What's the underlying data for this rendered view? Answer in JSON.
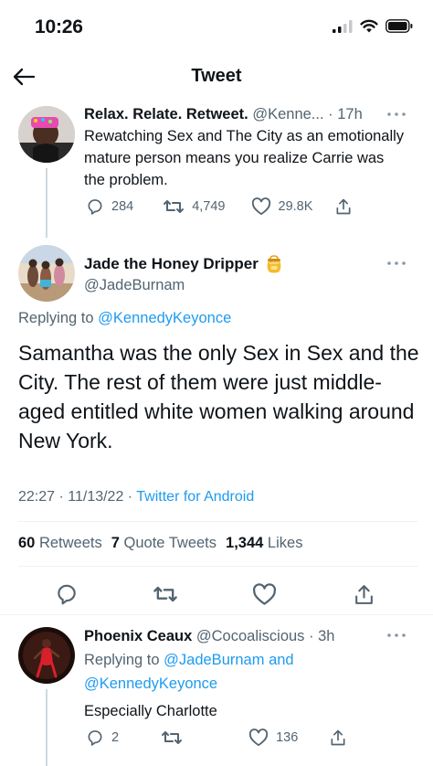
{
  "status_bar": {
    "time": "10:26"
  },
  "nav": {
    "title": "Tweet"
  },
  "parent_tweet": {
    "display_name": "Relax. Relate. Retweet.",
    "handle": "@Kenne...",
    "time": "· 17h",
    "text": "Rewatching Sex and The City as an emotionally mature person means you realize Carrie was the problem.",
    "replies": "284",
    "retweets": "4,749",
    "likes": "29.8K"
  },
  "main_tweet": {
    "display_name": "Jade the Honey Dripper",
    "handle": "@JadeBurnam",
    "replying_prefix": "Replying to",
    "replying_to": "@KennedyKeyonce",
    "text": "Samantha was the only Sex in Sex and the City. The rest of them were just middle-aged entitled white women walking around New York.",
    "datetime": "22:27 · 11/13/22 ·",
    "source": "Twitter for Android",
    "retweets_count": "60",
    "retweets_label": "Retweets",
    "quotes_count": "7",
    "quotes_label": "Quote Tweets",
    "likes_count": "1,344",
    "likes_label": "Likes"
  },
  "reply_tweet": {
    "display_name": "Phoenix Ceaux",
    "handle": "@Cocoaliscious",
    "time": "· 3h",
    "replying_prefix": "Replying to",
    "replying_to_1": "@JadeBurnam",
    "replying_and": "and",
    "replying_to_2": "@KennedyKeyonce",
    "text": "Especially Charlotte",
    "replies": "2",
    "likes": "136"
  },
  "colors": {
    "accent": "#1d9bf0",
    "text": "#0f1419",
    "muted": "#536471",
    "divider": "#eff3f4"
  },
  "icons": [
    "back-arrow-icon",
    "more-icon",
    "reply-icon",
    "retweet-icon",
    "like-icon",
    "share-icon",
    "honey-pot-icon",
    "signal-icon",
    "wifi-icon",
    "battery-icon"
  ]
}
